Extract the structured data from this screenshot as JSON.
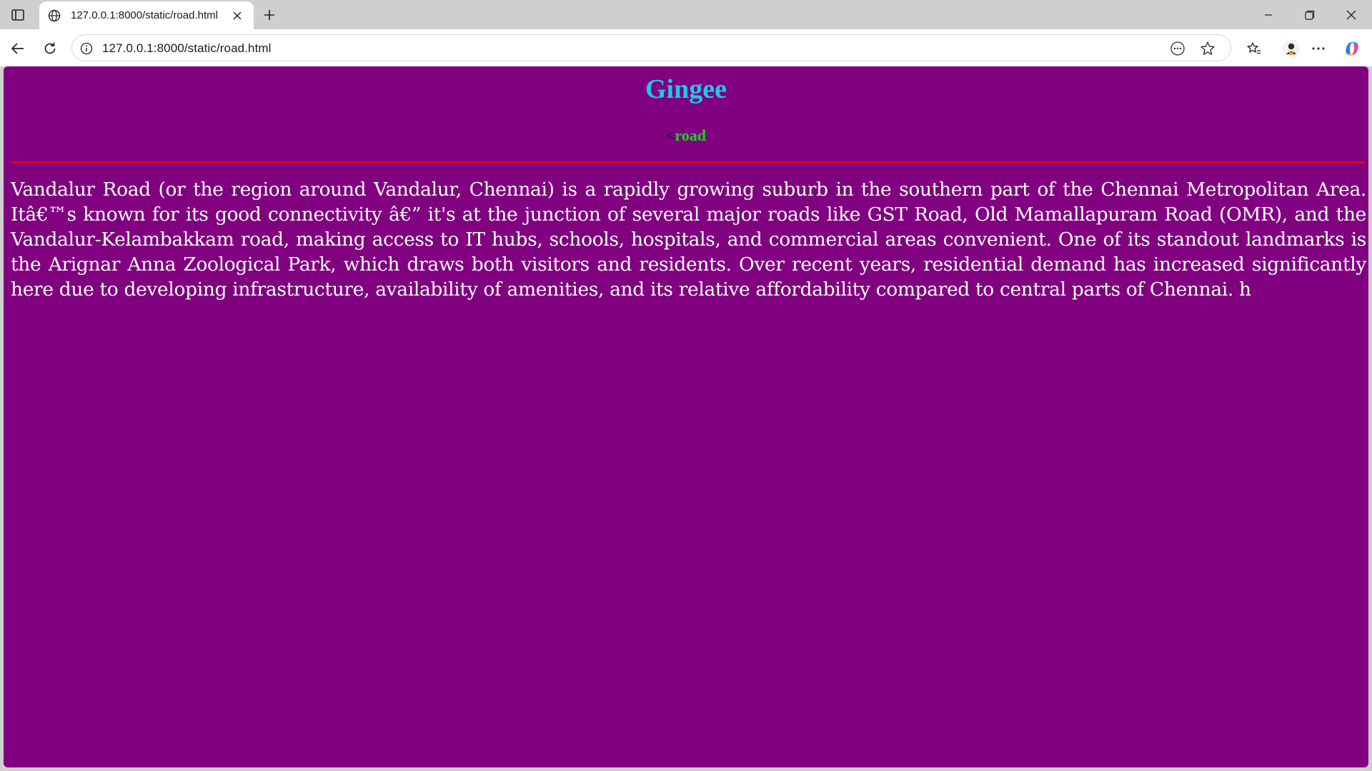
{
  "browser": {
    "tab": {
      "title": "127.0.0.1:8000/static/road.html"
    },
    "address_bar": {
      "url": "127.0.0.1:8000/static/road.html"
    }
  },
  "page": {
    "title": "Gingee",
    "subtitle_prefix": "<",
    "subtitle_link": "road",
    "paragraph": "Vandalur Road (or the region around Vandalur, Chennai) is a rapidly growing suburb in the southern part of the Chennai Metropolitan Area. Itâ€™s known for its good connectivity â€” it's at the junction of several major roads like GST Road, Old Mamallapuram Road (OMR), and the Vandalur-Kelambakkam road, making access to IT hubs, schools, hospitals, and commercial areas convenient. One of its standout landmarks is the Arignar Anna Zoological Park, which draws both visitors and residents. Over recent years, residential demand has increased significantly here due to developing infrastructure, availability of amenities, and its relative affordability compared to central parts of Chennai. h"
  },
  "colors": {
    "page_background": "#800080",
    "title_color": "#1ec8e8",
    "link_color": "#18d818",
    "divider_color": "#e3001b",
    "text_color": "#ffffff"
  }
}
